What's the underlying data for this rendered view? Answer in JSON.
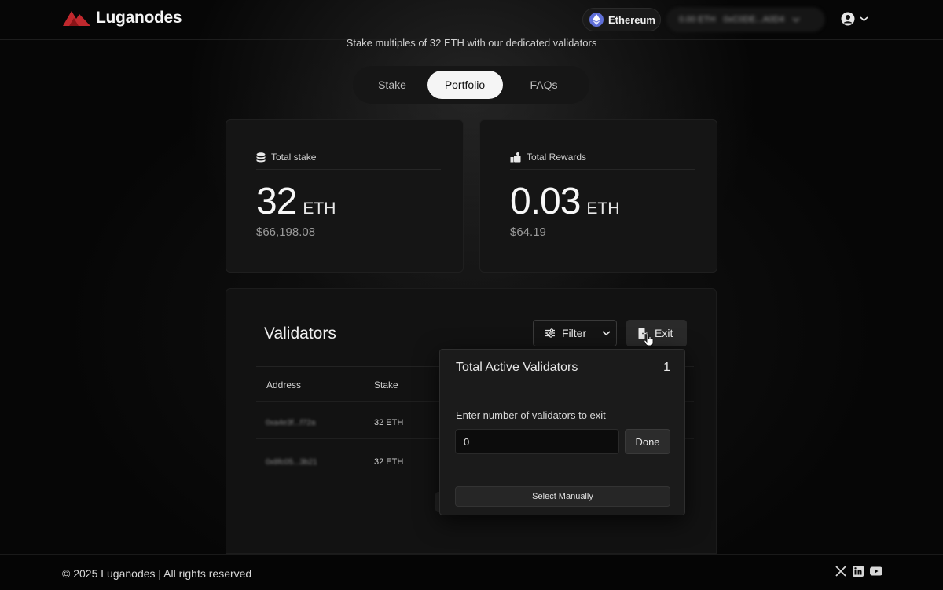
{
  "brand": {
    "name": "Luganodes",
    "accent": "#c0282d"
  },
  "header": {
    "network": "Ethereum",
    "wallet_balance": "0.00 ETH",
    "wallet_address": "0xC0DE...A0D4"
  },
  "subtitle": "Stake multiples of 32 ETH with our dedicated validators",
  "tabs": [
    {
      "label": "Stake",
      "active": false
    },
    {
      "label": "Portfolio",
      "active": true
    },
    {
      "label": "FAQs",
      "active": false
    }
  ],
  "stats": {
    "total_stake": {
      "label": "Total stake",
      "value": "32",
      "unit": "ETH",
      "usd": "$66,198.08",
      "icon": "coins-stack-icon"
    },
    "total_rewards": {
      "label": "Total Rewards",
      "value": "0.03",
      "unit": "ETH",
      "usd": "$64.19",
      "icon": "rewards-icon"
    }
  },
  "validators": {
    "title": "Validators",
    "filter_label": "Filter",
    "exit_label": "Exit",
    "columns": {
      "address": "Address",
      "stake": "Stake"
    },
    "rows": [
      {
        "address": "0xa4e3f...f72a",
        "stake": "32 ETH"
      },
      {
        "address": "0x8fc05...3b21",
        "stake": "32 ETH"
      }
    ]
  },
  "exit_popover": {
    "title": "Total Active Validators",
    "count": "1",
    "input_label": "Enter number of validators to exit",
    "input_value": "0",
    "done_label": "Done",
    "select_manually_label": "Select Manually"
  },
  "footer": {
    "copyright": "© 2025 Luganodes | All rights reserved",
    "socials": [
      "x-icon",
      "linkedin-icon",
      "youtube-icon"
    ]
  }
}
